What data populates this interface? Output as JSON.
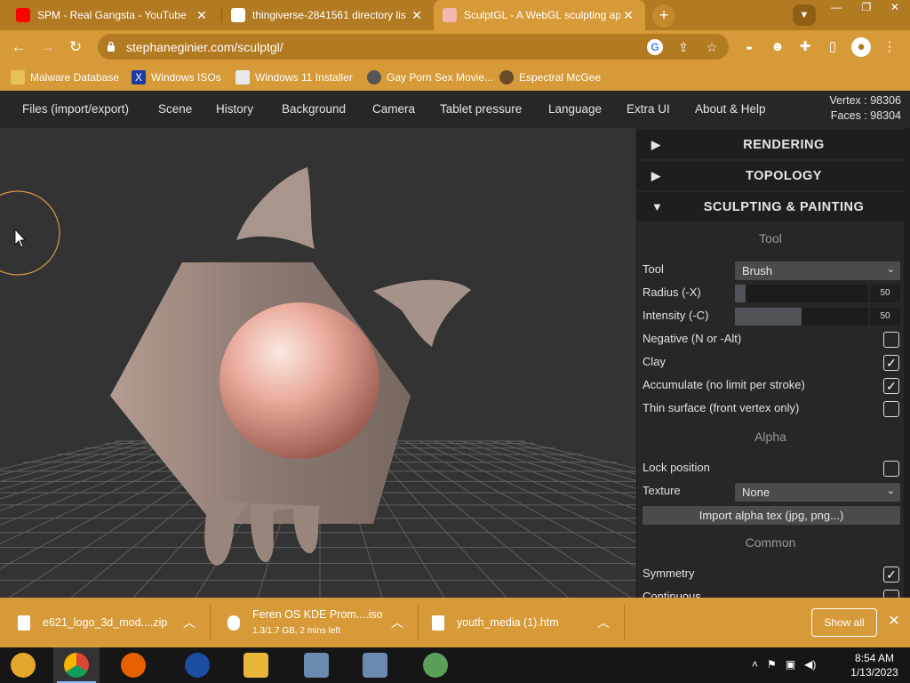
{
  "browser": {
    "tabs": [
      {
        "title": "SPM - Real Gangsta - YouTube",
        "icon": "youtube-icon"
      },
      {
        "title": "thingiverse-2841561 directory lis",
        "icon": "archive-icon"
      },
      {
        "title": "SculptGL - A WebGL sculpting ap",
        "icon": "sculptgl-icon"
      }
    ],
    "url": "stephaneginier.com/sculptgl/",
    "accent": "#d79a38",
    "strip_color": "#b27a21"
  },
  "bookmarks": [
    {
      "label": "Malware Database",
      "icon": "yellow-box-icon"
    },
    {
      "label": "Windows ISOs",
      "icon": "x-box-icon"
    },
    {
      "label": "Windows 11 Installer",
      "icon": "photo-icon"
    },
    {
      "label": "Gay Porn Sex Movie...",
      "icon": "pawprint-icon"
    },
    {
      "label": "Espectral McGee",
      "icon": "mask-icon"
    }
  ],
  "app": {
    "menu": [
      "Files (import/export)",
      "Scene",
      "History",
      "Background",
      "Camera",
      "Tablet pressure",
      "Language",
      "Extra UI",
      "About & Help"
    ],
    "vertex": "Vertex : 98306",
    "faces": "Faces : 98304"
  },
  "panel": {
    "folds": {
      "rendering": {
        "arrow": "▶",
        "title": "RENDERING"
      },
      "topology": {
        "arrow": "▶",
        "title": "TOPOLOGY"
      },
      "sculpting": {
        "arrow": "▼",
        "title": "SCULPTING & PAINTING"
      }
    },
    "sections": {
      "tool": "Tool",
      "alpha": "Alpha",
      "common": "Common"
    },
    "tool": {
      "label": "Tool",
      "value": "Brush"
    },
    "radius": {
      "label": "Radius (-X)",
      "value": "50",
      "fraction": 0.08
    },
    "intensity": {
      "label": "Intensity (-C)",
      "value": "50",
      "fraction": 0.5
    },
    "negative": {
      "label": "Negative (N or -Alt)",
      "checked": false
    },
    "clay": {
      "label": "Clay",
      "checked": true
    },
    "accumulate": {
      "label": "Accumulate (no limit per stroke)",
      "checked": true
    },
    "thin": {
      "label": "Thin surface (front vertex only)",
      "checked": false
    },
    "lock": {
      "label": "Lock position",
      "checked": false
    },
    "texture": {
      "label": "Texture",
      "value": "None"
    },
    "import_alpha": "Import alpha tex (jpg, png...)",
    "symmetry": {
      "label": "Symmetry",
      "checked": true
    },
    "continuous": {
      "label": "Continuous",
      "checked": false
    }
  },
  "downloads": [
    {
      "name": "e621_logo_3d_mod....zip",
      "status": ""
    },
    {
      "name": "Feren OS KDE Prom....iso",
      "status": "1.3/1.7 GB, 2 mins left"
    },
    {
      "name": "youth_media (1).htm",
      "status": ""
    }
  ],
  "downloads_show_all": "Show all",
  "taskbar": {
    "apps": [
      "chrome-canary-icon",
      "chrome-icon",
      "firefox-icon",
      "obama-logo-icon",
      "file-explorer-icon",
      "network-tool-icon",
      "network-tool-2-icon",
      "network-people-icon"
    ],
    "time": "8:54 AM",
    "date": "1/13/2023"
  }
}
